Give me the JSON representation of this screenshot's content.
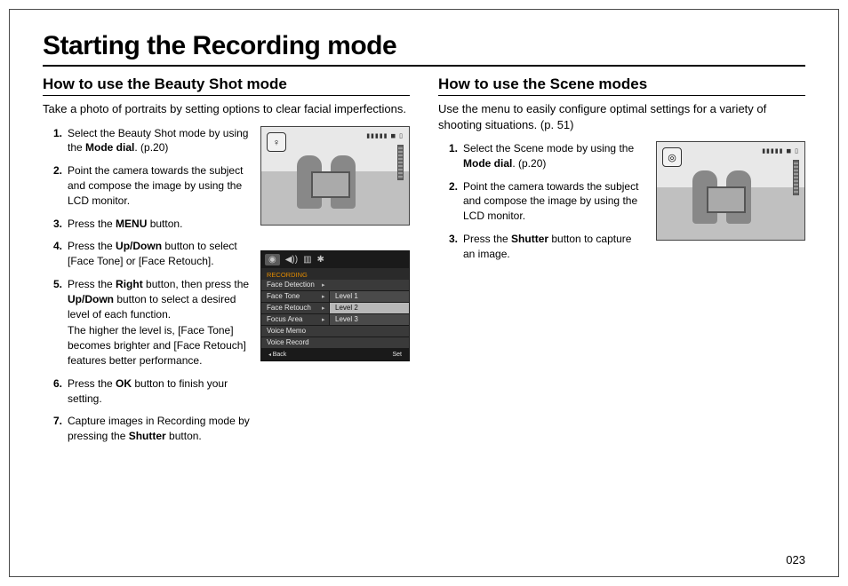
{
  "page": {
    "title": "Starting the Recording mode",
    "number": "023"
  },
  "left": {
    "heading": "How to use the Beauty Shot mode",
    "intro": "Take a photo of portraits by setting options to clear facial imperfections.",
    "steps": {
      "s1a": "Select the Beauty Shot mode by using the ",
      "s1b": "Mode dial",
      "s1c": ". (p.20)",
      "s2": "Point the camera towards the subject and compose the image by using the LCD monitor.",
      "s3a": "Press the ",
      "s3b": "MENU",
      "s3c": " button.",
      "s4a": "Press the ",
      "s4b": "Up/Down",
      "s4c": " button to select [Face Tone] or [Face Retouch].",
      "s5a": "Press the ",
      "s5b": "Right",
      "s5c": " button, then press the ",
      "s5d": "Up/Down",
      "s5e": " button to select a desired level of each function.",
      "s5extra": "The higher the level is, [Face Tone] becomes brighter and [Face Retouch] features better performance.",
      "s6a": "Press the ",
      "s6b": "OK",
      "s6c": " button to finish your setting.",
      "s7a": "Capture images in Recording mode by pressing the ",
      "s7b": "Shutter",
      "s7c": " button."
    },
    "thumb_badge": "♀",
    "thumb_top": "▮▮▮▮▮ ◼ ▯"
  },
  "right": {
    "heading": "How to use the Scene modes",
    "intro": "Use the menu to easily configure optimal settings for a variety of shooting situations. (p. 51)",
    "steps": {
      "s1a": "Select the Scene mode by using the ",
      "s1b": "Mode dial",
      "s1c": ". (p.20)",
      "s2": "Point the camera towards the subject and compose the image by using the LCD monitor.",
      "s3a": "Press the ",
      "s3b": "Shutter",
      "s3c": " button to capture an image."
    },
    "thumb_badge": "◎",
    "thumb_top": "▮▮▮▮▮ ◼ ▯"
  },
  "menu": {
    "tabs": {
      "t1": "◉",
      "t2": "◀))",
      "t3": "▥",
      "t4": "✱"
    },
    "section": "RECORDING",
    "rows": {
      "r1": {
        "label": "Face Detection",
        "sub": ""
      },
      "r2": {
        "label": "Face Tone",
        "sub": "Level 1"
      },
      "r3": {
        "label": "Face Retouch",
        "sub": "Level 2"
      },
      "r4": {
        "label": "Focus Area",
        "sub": "Level 3"
      },
      "r5": {
        "label": "Voice Memo",
        "sub": ""
      },
      "r6": {
        "label": "Voice Record",
        "sub": ""
      }
    },
    "footer": {
      "back": "Back",
      "set": "Set"
    }
  }
}
